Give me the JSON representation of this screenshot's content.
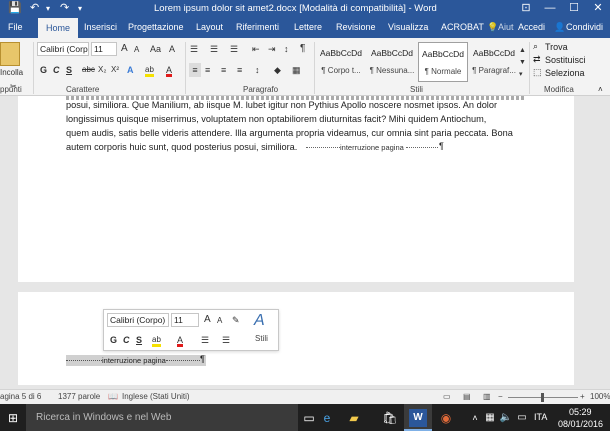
{
  "window": {
    "title": "Lorem ipsum dolor sit amet2.docx [Modalità di compatibilità] - Word",
    "qa_save": "💾",
    "qa_undo": "↶",
    "qa_redo": "↷",
    "qa_more": "▾",
    "min": "—",
    "max": "☐",
    "close": "✕",
    "ribbon_toggle": "⊡"
  },
  "tabs": {
    "file": "File",
    "home": "Home",
    "insert": "Inserisci",
    "design": "Progettazione",
    "layout": "Layout",
    "references": "Riferimenti",
    "mailings": "Lettere",
    "review": "Revisione",
    "view": "Visualizza",
    "acrobat": "ACROBAT",
    "tellme": "Aiut",
    "signin": "Accedi",
    "share": "Condividi"
  },
  "ribbon": {
    "clipboard": {
      "paste": "Incolla",
      "label": "ppunti"
    },
    "font": {
      "label": "Carattere",
      "font_name": "Calibri (Corp",
      "font_size": "11",
      "grow": "A",
      "shrink": "A",
      "case": "Aa",
      "clear": "A",
      "bold": "G",
      "italic": "C",
      "underline": "S",
      "strike": "abc",
      "sub": "X₂",
      "sup": "X²",
      "effects": "A",
      "highlight": "ab",
      "color": "A"
    },
    "paragraph": {
      "label": "Paragrafo",
      "pilcrow": "¶"
    },
    "styles": {
      "label": "Stili",
      "items": [
        {
          "sample": "AaBbCcDd",
          "name": "¶ Corpo t..."
        },
        {
          "sample": "AaBbCcDd",
          "name": "¶ Nessuna..."
        },
        {
          "sample": "AaBbCcDd",
          "name": "¶ Normale"
        },
        {
          "sample": "AaBbCcDd",
          "name": "¶ Paragraf..."
        }
      ]
    },
    "editing": {
      "label": "Modifica",
      "find": "Trova",
      "replace": "Sostituisci",
      "select": "Seleziona"
    }
  },
  "document": {
    "page1_lines": [
      "posui, similiora. Que Manilium, ab iisque M. lubet igitur non Pythius Apollo noscere nosmet ipsos. An dolor",
      "longissimus quisque miserrimus, voluptatem non optabiliorem diuturnitas facit? Mihi quidem Antiochum,",
      "quem audis, satis belle videris attendere. Illa argumenta propria videamus, cur omnia sint paria peccata. Bona",
      "autem corporis huic sunt, quod posterius posui, similiora."
    ],
    "page_break_1": "interruzione pagina",
    "page_break_2": "interruzione pagina",
    "pilcrow": "¶"
  },
  "mini_toolbar": {
    "font": "Calibri (Corpo)",
    "size": "11",
    "grow": "A",
    "shrink": "A",
    "bold": "G",
    "italic": "C",
    "underline": "S",
    "highlight": "ab",
    "color": "A",
    "styles_label": "Stili"
  },
  "statusbar": {
    "page": "agina 5 di 6",
    "words": "1377 parole",
    "language": "Inglese (Stati Uniti)",
    "zoom": "100%"
  },
  "taskbar": {
    "search_placeholder": "Ricerca in Windows e nel Web",
    "lang": "ITA",
    "time": "05:29",
    "date": "08/01/2016"
  },
  "colors": {
    "word_blue": "#2b579a",
    "highlight_yellow": "#f5e100",
    "font_red": "#e01a1a"
  }
}
